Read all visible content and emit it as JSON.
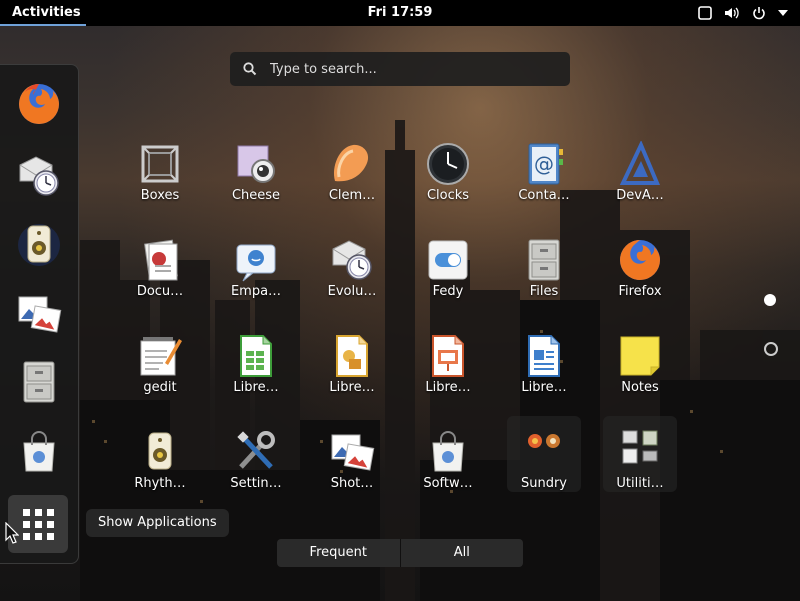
{
  "topbar": {
    "activities_label": "Activities",
    "clock": "Fri 17:59",
    "tray_icons": [
      "screen-icon",
      "volume-icon",
      "power-icon",
      "chevron-down-icon"
    ]
  },
  "search": {
    "placeholder": "Type to search..."
  },
  "dash": {
    "items": [
      {
        "icon": "firefox-icon"
      },
      {
        "icon": "evolution-mail-icon"
      },
      {
        "icon": "rhythmbox-icon"
      },
      {
        "icon": "shotwell-icon"
      },
      {
        "icon": "files-icon"
      },
      {
        "icon": "software-icon"
      }
    ],
    "show_apps_tooltip": "Show Applications"
  },
  "apps": [
    {
      "label": "Boxes",
      "icon": "boxes-icon"
    },
    {
      "label": "Cheese",
      "icon": "cheese-icon"
    },
    {
      "label": "Clem…",
      "icon": "clementine-icon"
    },
    {
      "label": "Clocks",
      "icon": "clocks-icon"
    },
    {
      "label": "Conta…",
      "icon": "contacts-icon"
    },
    {
      "label": "DevA…",
      "icon": "devassistant-icon"
    },
    {
      "label": "Docu…",
      "icon": "documents-icon"
    },
    {
      "label": "Empa…",
      "icon": "empathy-icon"
    },
    {
      "label": "Evolu…",
      "icon": "evolution-icon"
    },
    {
      "label": "Fedy",
      "icon": "fedy-icon"
    },
    {
      "label": "Files",
      "icon": "files-icon"
    },
    {
      "label": "Firefox",
      "icon": "firefox-icon"
    },
    {
      "label": "gedit",
      "icon": "gedit-icon"
    },
    {
      "label": "Libre…",
      "icon": "libreoffice-calc-icon"
    },
    {
      "label": "Libre…",
      "icon": "libreoffice-draw-icon"
    },
    {
      "label": "Libre…",
      "icon": "libreoffice-impress-icon"
    },
    {
      "label": "Libre…",
      "icon": "libreoffice-writer-icon"
    },
    {
      "label": "Notes",
      "icon": "notes-icon"
    },
    {
      "label": "Rhyth…",
      "icon": "rhythmbox-icon"
    },
    {
      "label": "Settin…",
      "icon": "settings-icon"
    },
    {
      "label": "Shot…",
      "icon": "shotwell-icon"
    },
    {
      "label": "Softw…",
      "icon": "software-icon"
    },
    {
      "label": "Sundry",
      "icon": "sundry-folder-icon"
    },
    {
      "label": "Utiliti…",
      "icon": "utilities-folder-icon"
    }
  ],
  "pages": {
    "count": 2,
    "current": 1
  },
  "view_tabs": [
    {
      "label": "Frequent",
      "active": false
    },
    {
      "label": "All",
      "active": true
    }
  ],
  "colors": {
    "accent": "#6fa1d8",
    "topbar": "#000000"
  }
}
